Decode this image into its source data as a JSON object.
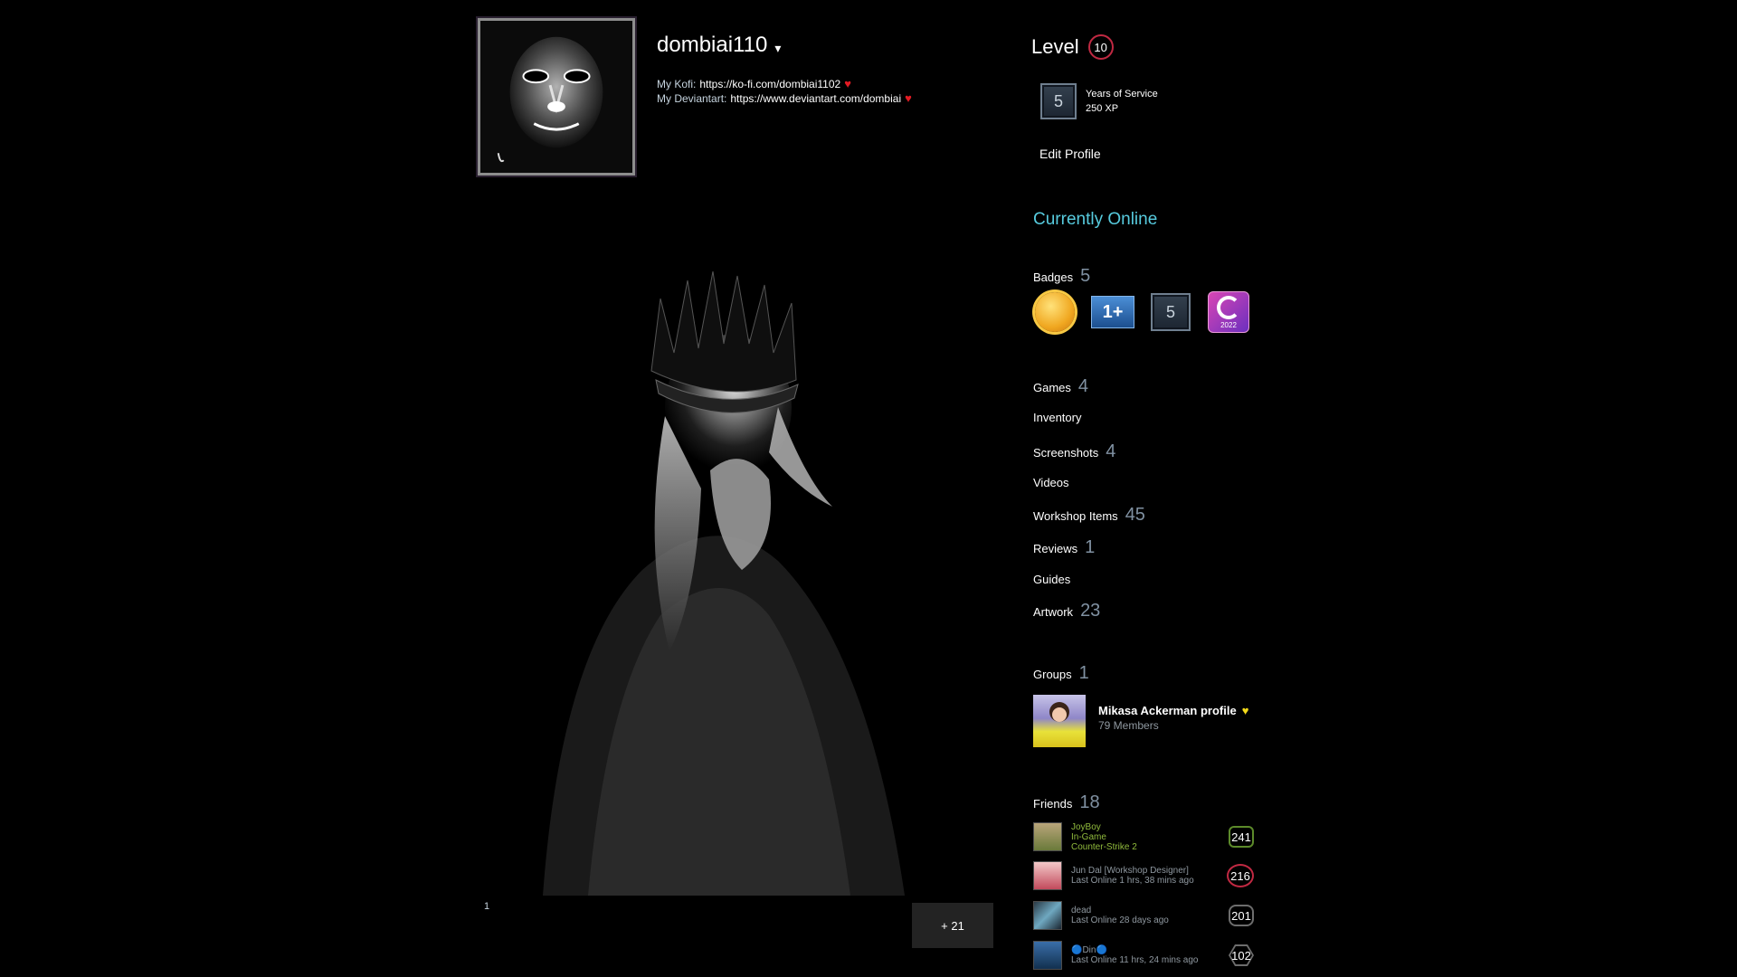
{
  "profile": {
    "persona_name": "dombiai110",
    "summary": [
      {
        "label": "My Kofi:",
        "link": "https://ko-fi.com/dombiai1102"
      },
      {
        "label": "My Deviantart:",
        "link": "https://www.deviantart.com/dombiai"
      }
    ]
  },
  "level": {
    "label": "Level",
    "value": "10",
    "favorite_badge": {
      "icon_text": "5",
      "name": "Years of Service",
      "xp": "250 XP"
    },
    "edit_profile": "Edit Profile",
    "status": "Currently Online"
  },
  "badges": {
    "label": "Badges",
    "count": "5",
    "items": [
      {
        "icon": "coin-badge-icon"
      },
      {
        "icon": "years-badge-icon",
        "text": "1+"
      },
      {
        "icon": "service-badge-icon",
        "text": "5"
      },
      {
        "icon": "community-badge-icon",
        "text": "2022"
      }
    ]
  },
  "stats": [
    {
      "label": "Games",
      "count": "4"
    },
    {
      "label": "Inventory",
      "count": ""
    },
    {
      "label": "Screenshots",
      "count": "4"
    },
    {
      "label": "Videos",
      "count": ""
    },
    {
      "label": "Workshop Items",
      "count": "45"
    },
    {
      "label": "Reviews",
      "count": "1"
    },
    {
      "label": "Guides",
      "count": ""
    },
    {
      "label": "Artwork",
      "count": "23"
    }
  ],
  "groups": {
    "label": "Groups",
    "count": "1",
    "items": [
      {
        "name": "Mikasa Ackerman profile",
        "members": "79 Members"
      }
    ]
  },
  "friends": {
    "label": "Friends",
    "count": "18",
    "items": [
      {
        "name": "JoyBoy",
        "status": "In-Game",
        "detail": "Counter-Strike 2",
        "level": "241"
      },
      {
        "name": "Jun Dal [Workshop Designer]",
        "status": "Last Online 1 hrs, 38 mins ago",
        "detail": "",
        "level": "216"
      },
      {
        "name": "dead",
        "status": "Last Online 28 days ago",
        "detail": "",
        "level": "201"
      },
      {
        "name": "🔵Din🔵",
        "status": "Last Online 11 hrs, 24 mins ago",
        "detail": "",
        "level": "102"
      }
    ]
  },
  "showcase": {
    "page": "1",
    "more_label": "+ 21"
  },
  "colors": {
    "background": "#000000",
    "online": "#57cbde",
    "ingame": "#90ba3c",
    "level_ring": "#c02942",
    "heart": "#e31b23"
  }
}
